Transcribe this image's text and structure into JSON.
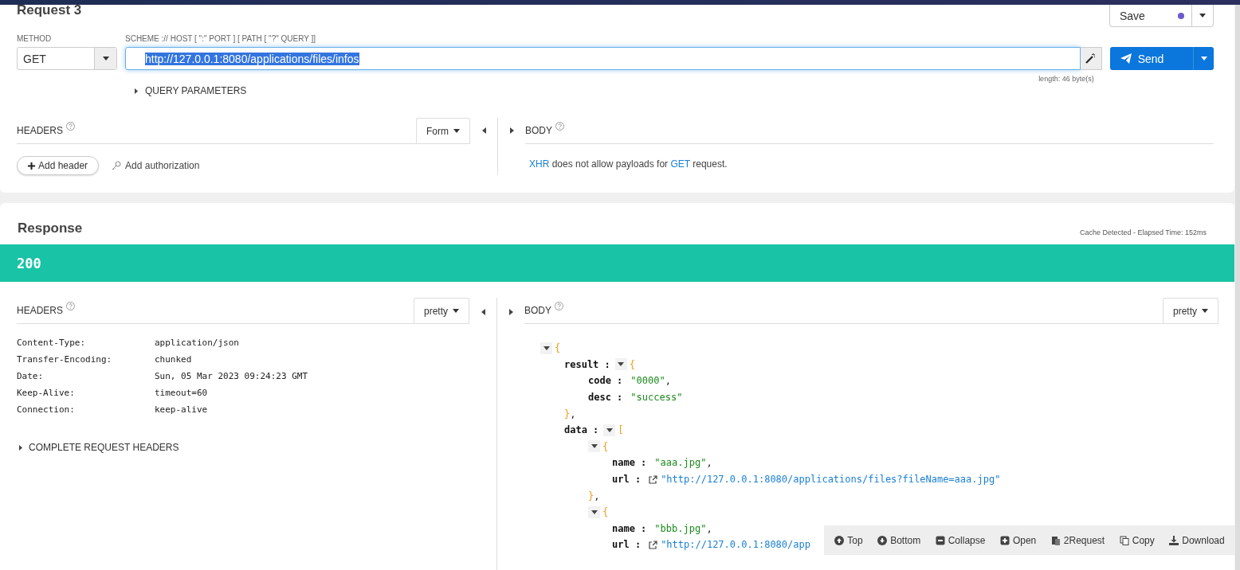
{
  "request": {
    "title": "Request 3",
    "save": {
      "label": "Save",
      "unsaved": true
    },
    "method_label": "METHOD",
    "method": "GET",
    "url_label": "SCHEME :// HOST [ \":\" PORT ] [ PATH [ \"?\" QUERY ]]",
    "url": "http://127.0.0.1:8080/applications/files/infos",
    "url_selected": true,
    "length": "length: 46 byte(s)",
    "send": "Send",
    "query_toggle": {
      "label": "QUERY PARAMETERS",
      "expanded": false
    },
    "headers": {
      "title": "HEADERS",
      "mode": "Form",
      "add_header": "Add header",
      "add_authorization": "Add authorization"
    },
    "body": {
      "title": "BODY",
      "message": [
        {
          "text": "XHR",
          "highlight": true
        },
        {
          "text": " does not allow payloads for ",
          "highlight": false
        },
        {
          "text": "GET",
          "highlight": true
        },
        {
          "text": " request.",
          "highlight": false
        }
      ]
    }
  },
  "response": {
    "title": "Response",
    "info": "Cache Detected - Elapsed Time: 152ms",
    "status": "200",
    "headers": {
      "title": "HEADERS",
      "mode": "pretty",
      "rows": [
        {
          "name": "Content-Type:",
          "value": "application/json"
        },
        {
          "name": "Transfer-Encoding:",
          "value": "chunked"
        },
        {
          "name": "Date:",
          "value": "Sun, 05 Mar 2023 09:24:23 GMT"
        },
        {
          "name": "Keep-Alive:",
          "value": "timeout=60"
        },
        {
          "name": "Connection:",
          "value": "keep-alive"
        }
      ],
      "complete_toggle": {
        "label": "COMPLETE REQUEST HEADERS",
        "expanded": false
      }
    },
    "body": {
      "title": "BODY",
      "mode": "pretty",
      "tree": [
        {
          "open": "{",
          "expanded": true,
          "children": [
            {
              "key": "result :",
              "open": "{",
              "expanded": true,
              "close": "}",
              "close_after": ",",
              "children": [
                {
                  "key": "code :",
                  "value": "\"0000\"",
                  "kind": "string",
                  "after": ","
                },
                {
                  "key": "desc :",
                  "value": "\"success\"",
                  "kind": "string"
                }
              ]
            },
            {
              "key": "data :",
              "open": "[",
              "expanded": true,
              "children": [
                {
                  "open": "{",
                  "expanded": true,
                  "close": "}",
                  "close_after": ",",
                  "children": [
                    {
                      "key": "name :",
                      "value": "\"aaa.jpg\"",
                      "kind": "string",
                      "after": ","
                    },
                    {
                      "key": "url :",
                      "value": "\"http://127.0.0.1:8080/applications/files?fileName=aaa.jpg\"",
                      "kind": "url"
                    }
                  ]
                },
                {
                  "open": "{",
                  "expanded": true,
                  "children": [
                    {
                      "key": "name :",
                      "value": "\"bbb.jpg\"",
                      "kind": "string",
                      "after": ","
                    },
                    {
                      "key": "url :",
                      "value": "\"http://127.0.0.1:8080/app",
                      "kind": "url"
                    }
                  ]
                }
              ]
            }
          ]
        }
      ]
    },
    "toolbar": [
      {
        "label": "Top",
        "kind": "up"
      },
      {
        "label": "Bottom",
        "kind": "down"
      },
      {
        "label": "Collapse",
        "kind": "minus"
      },
      {
        "label": "Open",
        "kind": "plus"
      },
      {
        "label": "2Request",
        "kind": "paste"
      },
      {
        "label": "Copy",
        "kind": "copy"
      },
      {
        "label": "Download",
        "kind": "download"
      }
    ]
  }
}
